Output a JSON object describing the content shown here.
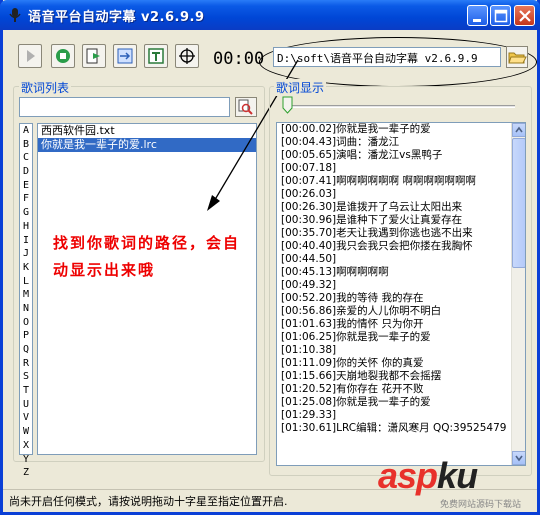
{
  "window": {
    "title": "语音平台自动字幕 v2.6.9.9"
  },
  "toolbar": {
    "time": "00:00",
    "path_value": "D:\\soft\\语音平台自动字幕 v2.6.9.9"
  },
  "left": {
    "group_title": "歌词列表",
    "alphabet": [
      "A",
      "B",
      "C",
      "D",
      "E",
      "F",
      "G",
      "H",
      "I",
      "J",
      "K",
      "L",
      "M",
      "N",
      "O",
      "P",
      "Q",
      "R",
      "S",
      "T",
      "U",
      "V",
      "W",
      "X",
      "Y",
      "Z"
    ],
    "files": [
      {
        "name": "西西软件园.txt",
        "selected": false
      },
      {
        "name": "你就是我一辈子的爱.lrc",
        "selected": true
      }
    ],
    "annotation": "找到你歌词的路径，会自动显示出来哦"
  },
  "right": {
    "group_title": "歌词显示",
    "lyrics": [
      "[00:00.02]你就是我一辈子的爱",
      "[00:04.43]词曲：潘龙江",
      "[00:05.65]演唱：潘龙江vs黑鸭子",
      "[00:07.18]",
      "[00:07.41]啊啊啊啊啊啊 啊啊啊啊啊啊啊",
      "[00:26.03]",
      "[00:26.30]是谁拨开了乌云让太阳出来",
      "[00:30.96]是谁种下了爱火让真爱存在",
      "[00:35.70]老天让我遇到你逃也逃不出来",
      "[00:40.40]我只会我只会把你搂在我胸怀",
      "[00:44.50]",
      "[00:45.13]啊啊啊啊啊",
      "[00:49.32]",
      "[00:52.20]我的等待 我的存在",
      "[00:56.86]亲爱的人儿你明不明白",
      "[01:01.63]我的情怀 只为你开",
      "[01:06.25]你就是我一辈子的爱",
      "[01:10.38]",
      "[01:11.09]你的关怀 你的真爱",
      "[01:15.66]天崩地裂我都不会摇摆",
      "[01:20.52]有你存在 花开不败",
      "[01:25.08]你就是我一辈子的爱",
      "[01:29.33]",
      "[01:30.61]LRC编辑：潇风寒月 QQ:39525479"
    ]
  },
  "status": {
    "text": "尚未开启任何模式，请按说明拖动十字星至指定位置开启."
  },
  "watermark": {
    "brand_a": "asp",
    "brand_b": "ku",
    "tagline": "免费网站源码下载站"
  }
}
